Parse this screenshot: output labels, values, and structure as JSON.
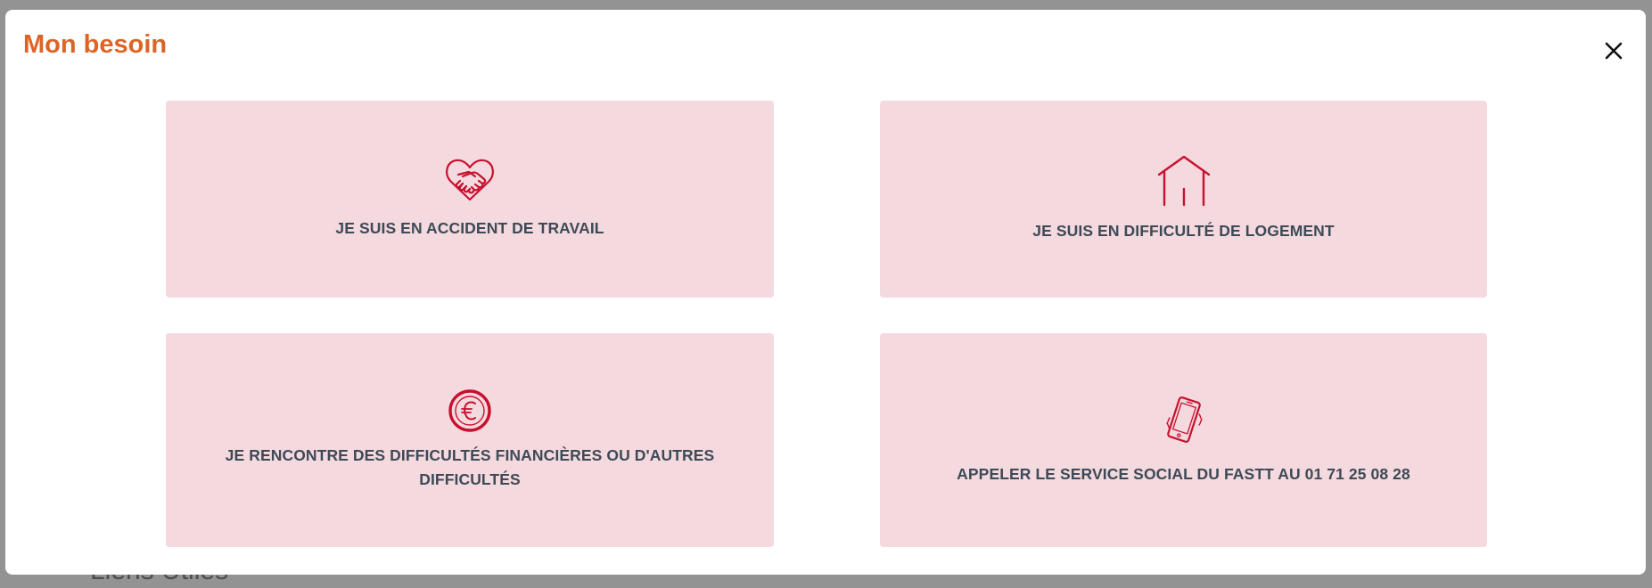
{
  "background": {
    "partial_text": "Liens Utiles"
  },
  "modal": {
    "title": "Mon besoin",
    "close_label": "×"
  },
  "cards": [
    {
      "label": "JE SUIS EN ACCIDENT DE TRAVAIL",
      "icon": "handshake-heart-icon"
    },
    {
      "label": "JE SUIS EN DIFFICULTÉ DE LOGEMENT",
      "icon": "house-icon"
    },
    {
      "label": "JE RENCONTRE DES DIFFICULTÉS FINANCIÈRES OU D'AUTRES DIFFICULTÉS",
      "icon": "euro-coin-icon"
    },
    {
      "label": "APPELER LE SERVICE SOCIAL DU FASTT AU 01 71 25 08 28",
      "icon": "phone-ringing-icon"
    }
  ],
  "colors": {
    "title": "#de6426",
    "card_background": "#f4d9de",
    "icon": "#c8102e",
    "label": "#3d4a57",
    "overlay": "#939393"
  }
}
